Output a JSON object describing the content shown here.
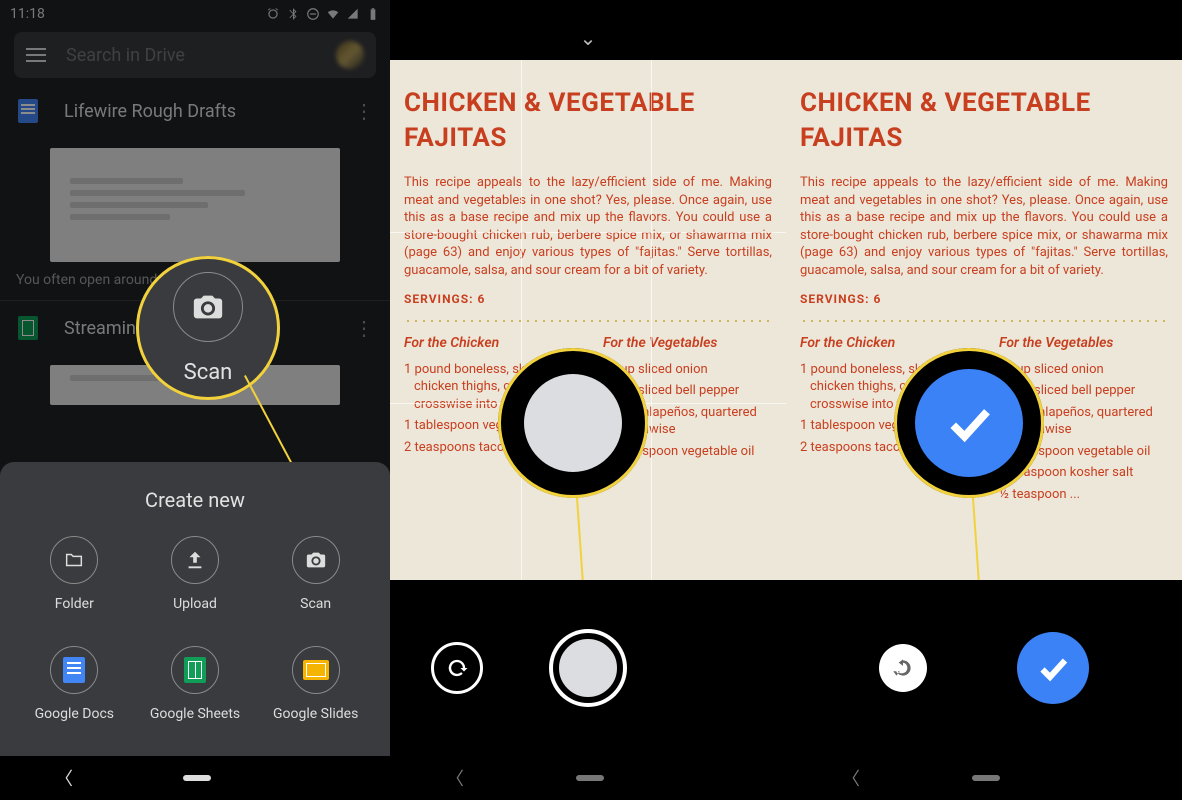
{
  "status": {
    "time": "11:18"
  },
  "search": {
    "placeholder": "Search in Drive"
  },
  "rows": {
    "r0": {
      "title": "Lifewire Rough Drafts"
    },
    "r1": {
      "title": "Streaming"
    }
  },
  "hint": "You often open around this time",
  "scan_big_label": "Scan",
  "sheet": {
    "title": "Create new",
    "items": {
      "folder": {
        "label": "Folder"
      },
      "upload": {
        "label": "Upload"
      },
      "scan": {
        "label": "Scan"
      },
      "docs": {
        "label": "Google Docs"
      },
      "sheets": {
        "label": "Google Sheets"
      },
      "slides": {
        "label": "Google Slides"
      }
    }
  },
  "recipe": {
    "title_l1": "CHICKEN & VEGETABLE",
    "title_l2": "FAJITAS",
    "para": "This recipe appeals to the lazy/efficient side of me. Making meat and vegetables in one shot? Yes, please. Once again, use this as a base recipe and mix up the flavors. You could use a store-bought chicken rub, berbere spice mix, or shawarma mix (page 63) and enjoy various types of \"fajitas.\" Serve tortillas, guacamole, salsa, and sour cream for a bit of variety.",
    "servings": "SERVINGS: 6",
    "col1_h": "For the Chicken",
    "col1": [
      "1  pound boneless, skinless chicken thighs, cut crosswise into thirds",
      "1  tablespoon vegetable oil",
      "2  teaspoons taco seasoning"
    ],
    "col2_h": "For the Vegetables",
    "col2": [
      "1  cup sliced onion",
      "1  cup sliced bell pepper",
      "1 or 2 jalapeños, quartered lengthwise",
      "1  tablespoon vegetable oil",
      "½  teaspoon kosher salt",
      "½  teaspoon ..."
    ]
  }
}
